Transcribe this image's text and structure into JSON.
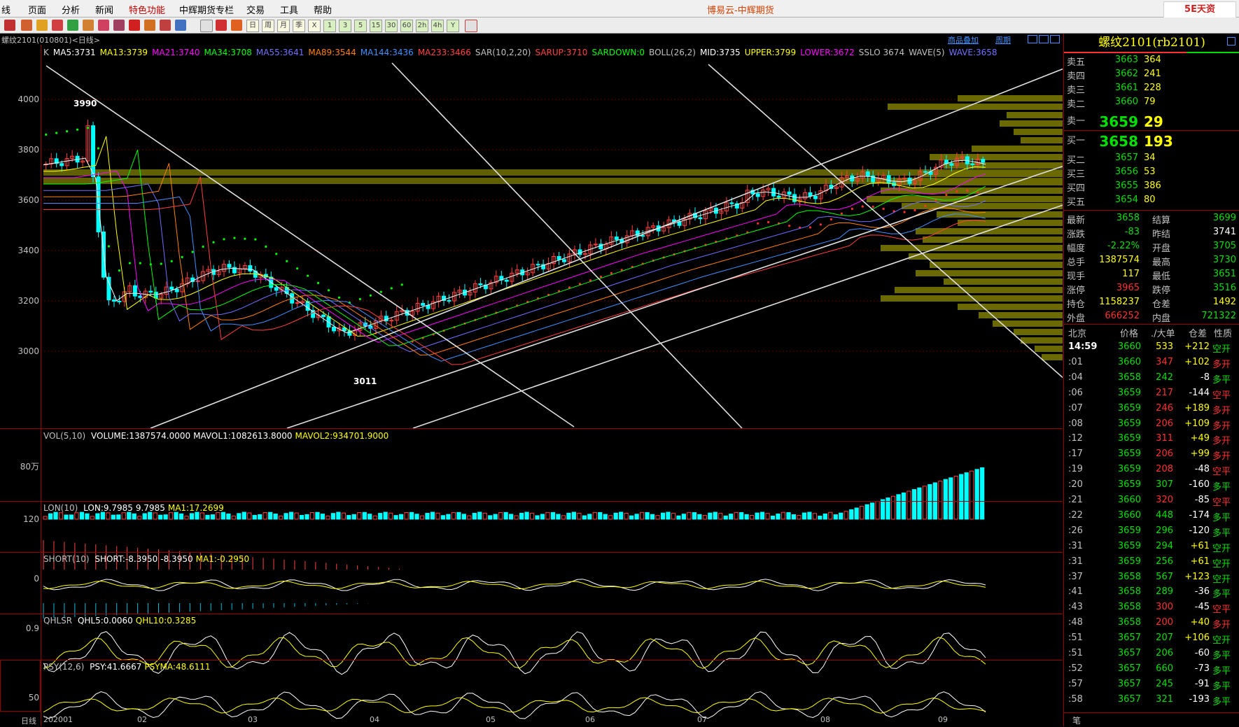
{
  "menu": {
    "items": [
      "线",
      "页面",
      "分析",
      "新闻",
      "特色功能",
      "中辉期货专栏",
      "交易",
      "工具",
      "帮助"
    ],
    "title": "博易云-中辉期货",
    "logo": "5E天资"
  },
  "toolbar": {
    "text_buttons": [
      "日",
      "周",
      "月",
      "季",
      "X",
      "1",
      "3",
      "5",
      "15",
      "30",
      "60",
      "2h",
      "4h",
      "Y"
    ]
  },
  "chart_header": {
    "instrument": "螺纹2101(010801)<日线>",
    "link_overlay": "商品叠加",
    "link_period": "周期"
  },
  "main_legend": [
    {
      "text": "K",
      "color": "#c0c0c0"
    },
    {
      "text": "MA5:3731",
      "color": "#ffffff"
    },
    {
      "text": "MA13:3739",
      "color": "#ffff00"
    },
    {
      "text": "MA21:3740",
      "color": "#ff00ff"
    },
    {
      "text": "MA34:3708",
      "color": "#00ff00"
    },
    {
      "text": "MA55:3641",
      "color": "#7070ff"
    },
    {
      "text": "MA89:3544",
      "color": "#ff8000"
    },
    {
      "text": "MA144:3436",
      "color": "#4090ff"
    },
    {
      "text": "MA233:3466",
      "color": "#ff4040"
    },
    {
      "text": "SAR(10,2,20)",
      "color": "#c0c0c0"
    },
    {
      "text": "SARUP:3710",
      "color": "#ff4040"
    },
    {
      "text": "SARDOWN:0",
      "color": "#00ff00"
    },
    {
      "text": "BOLL(26,2)",
      "color": "#c0c0c0"
    },
    {
      "text": "MID:3735",
      "color": "#ffffff"
    },
    {
      "text": "UPPER:3799",
      "color": "#ffff00"
    },
    {
      "text": "LOWER:3672",
      "color": "#ff00ff"
    },
    {
      "text": "SSLO 3674",
      "color": "#c0c0c0"
    },
    {
      "text": "WAVE(5)",
      "color": "#c0c0c0"
    },
    {
      "text": "WAVE:3658",
      "color": "#7070ff"
    }
  ],
  "y_axis_main": [
    "4000",
    "3800",
    "3600",
    "3400",
    "3200",
    "3000"
  ],
  "annotations": {
    "high": "3990",
    "low": "3011"
  },
  "x_axis": [
    "日线",
    "202001",
    "02",
    "03",
    "04",
    "05",
    "06",
    "07",
    "08",
    "09"
  ],
  "panels": {
    "vol": {
      "label": "VOL(5,10)",
      "items": [
        {
          "text": "VOLUME:1387574.0000",
          "color": "#ffffff"
        },
        {
          "text": "MAVOL1:1082613.8000",
          "color": "#ffffff"
        },
        {
          "text": "MAVOL2:934701.9000",
          "color": "#ffff00"
        }
      ],
      "ytick": "80万"
    },
    "lon": {
      "label": "LON(10)",
      "items": [
        {
          "text": "LON:9.7985",
          "color": "#ffffff"
        },
        {
          "text": "9.7985",
          "color": "#ffffff"
        },
        {
          "text": "MA1:17.2699",
          "color": "#ffff00"
        }
      ],
      "ytick": "120"
    },
    "short": {
      "label": "SHORT(10)",
      "items": [
        {
          "text": "SHORT:-8.3950",
          "color": "#ffffff"
        },
        {
          "text": "-8.3950",
          "color": "#ffffff"
        },
        {
          "text": "MA1:-0.2950",
          "color": "#ffff00"
        }
      ],
      "ytick": "0"
    },
    "qhlsr": {
      "label": "QHLSR",
      "items": [
        {
          "text": "QHL5:0.0060",
          "color": "#ffffff"
        },
        {
          "text": "QHL10:0.3285",
          "color": "#ffff00"
        }
      ],
      "ytick": "0.9"
    },
    "psy": {
      "label": "PSY(12,6)",
      "items": [
        {
          "text": "PSY:41.6667",
          "color": "#ffffff"
        },
        {
          "text": "PSYMA:48.6111",
          "color": "#ffff00"
        }
      ],
      "ytick": "50"
    }
  },
  "quote": {
    "title": "螺纹2101(rb2101)",
    "asks": [
      {
        "label": "卖五",
        "price": "3663",
        "vol": "364"
      },
      {
        "label": "卖四",
        "price": "3662",
        "vol": "241"
      },
      {
        "label": "卖三",
        "price": "3661",
        "vol": "228"
      },
      {
        "label": "卖二",
        "price": "3660",
        "vol": "79"
      },
      {
        "label": "卖一",
        "price": "3659",
        "vol": "29"
      }
    ],
    "bids": [
      {
        "label": "买一",
        "price": "3658",
        "vol": "193"
      },
      {
        "label": "买二",
        "price": "3657",
        "vol": "34"
      },
      {
        "label": "买三",
        "price": "3656",
        "vol": "53"
      },
      {
        "label": "买四",
        "price": "3655",
        "vol": "386"
      },
      {
        "label": "买五",
        "price": "3654",
        "vol": "80"
      }
    ],
    "stats": [
      {
        "l1": "最新",
        "v1": "3658",
        "c1": "#00e000",
        "l2": "结算",
        "v2": "3699",
        "c2": "#00e000"
      },
      {
        "l1": "涨跌",
        "v1": "-83",
        "c1": "#00e000",
        "l2": "昨结",
        "v2": "3741",
        "c2": "#ffffff"
      },
      {
        "l1": "幅度",
        "v1": "-2.22%",
        "c1": "#00e000",
        "l2": "开盘",
        "v2": "3705",
        "c2": "#00e000"
      },
      {
        "l1": "总手",
        "v1": "1387574",
        "c1": "#ffff00",
        "l2": "最高",
        "v2": "3730",
        "c2": "#00e000"
      },
      {
        "l1": "现手",
        "v1": "117",
        "c1": "#ffff00",
        "l2": "最低",
        "v2": "3651",
        "c2": "#00e000"
      },
      {
        "l1": "涨停",
        "v1": "3965",
        "c1": "#ff3030",
        "l2": "跌停",
        "v2": "3516",
        "c2": "#00e000"
      },
      {
        "l1": "持仓",
        "v1": "1158237",
        "c1": "#ffff00",
        "l2": "仓差",
        "v2": "1492",
        "c2": "#ffff00"
      },
      {
        "l1": "外盘",
        "v1": "666252",
        "c1": "#ff3030",
        "l2": "内盘",
        "v2": "721322",
        "c2": "#00e000"
      }
    ],
    "tick_header": {
      "loc": "北京",
      "price": "价格",
      "vol": "./大单",
      "diff": "仓差",
      "nature": "性质"
    },
    "ticks": [
      {
        "t": "14:59",
        "p": "3660",
        "v": "533",
        "vc": "#ffff00",
        "d": "+212",
        "n": "空开",
        "nc": "#00e000"
      },
      {
        "t": ":01",
        "p": "3660",
        "v": "347",
        "vc": "#ff3030",
        "d": "+102",
        "n": "多开",
        "nc": "#ff3030"
      },
      {
        "t": ":04",
        "p": "3658",
        "v": "242",
        "vc": "#00e000",
        "d": "-8",
        "n": "多平",
        "nc": "#00e000"
      },
      {
        "t": ":06",
        "p": "3659",
        "v": "217",
        "vc": "#ff3030",
        "d": "-144",
        "n": "空平",
        "nc": "#ff3030"
      },
      {
        "t": ":07",
        "p": "3659",
        "v": "246",
        "vc": "#ff3030",
        "d": "+189",
        "n": "多开",
        "nc": "#ff3030"
      },
      {
        "t": ":08",
        "p": "3659",
        "v": "206",
        "vc": "#ff3030",
        "d": "+109",
        "n": "多开",
        "nc": "#ff3030"
      },
      {
        "t": ":12",
        "p": "3659",
        "v": "311",
        "vc": "#ff3030",
        "d": "+49",
        "n": "多开",
        "nc": "#ff3030"
      },
      {
        "t": ":17",
        "p": "3659",
        "v": "206",
        "vc": "#ff3030",
        "d": "+99",
        "n": "多开",
        "nc": "#ff3030"
      },
      {
        "t": ":19",
        "p": "3659",
        "v": "208",
        "vc": "#ff3030",
        "d": "-48",
        "n": "空平",
        "nc": "#ff3030"
      },
      {
        "t": ":20",
        "p": "3659",
        "v": "307",
        "vc": "#00e000",
        "d": "-160",
        "n": "多平",
        "nc": "#00e000"
      },
      {
        "t": ":21",
        "p": "3660",
        "v": "320",
        "vc": "#ff3030",
        "d": "-85",
        "n": "空平",
        "nc": "#ff3030"
      },
      {
        "t": ":22",
        "p": "3660",
        "v": "448",
        "vc": "#00e000",
        "d": "-174",
        "n": "多平",
        "nc": "#00e000"
      },
      {
        "t": ":26",
        "p": "3659",
        "v": "296",
        "vc": "#00e000",
        "d": "-120",
        "n": "多平",
        "nc": "#00e000"
      },
      {
        "t": ":31",
        "p": "3659",
        "v": "294",
        "vc": "#00e000",
        "d": "+61",
        "n": "空开",
        "nc": "#00e000"
      },
      {
        "t": ":31",
        "p": "3659",
        "v": "256",
        "vc": "#00e000",
        "d": "+61",
        "n": "空开",
        "nc": "#00e000"
      },
      {
        "t": ":37",
        "p": "3658",
        "v": "567",
        "vc": "#00e000",
        "d": "+123",
        "n": "空开",
        "nc": "#00e000"
      },
      {
        "t": ":41",
        "p": "3658",
        "v": "289",
        "vc": "#00e000",
        "d": "-36",
        "n": "多平",
        "nc": "#00e000"
      },
      {
        "t": ":43",
        "p": "3658",
        "v": "300",
        "vc": "#ff3030",
        "d": "-45",
        "n": "空平",
        "nc": "#ff3030"
      },
      {
        "t": ":48",
        "p": "3658",
        "v": "200",
        "vc": "#ff3030",
        "d": "+40",
        "n": "多开",
        "nc": "#ff3030"
      },
      {
        "t": ":51",
        "p": "3657",
        "v": "207",
        "vc": "#00e000",
        "d": "+106",
        "n": "空开",
        "nc": "#00e000"
      },
      {
        "t": ":51",
        "p": "3657",
        "v": "206",
        "vc": "#00e000",
        "d": "-60",
        "n": "多平",
        "nc": "#00e000"
      },
      {
        "t": ":52",
        "p": "3657",
        "v": "660",
        "vc": "#00e000",
        "d": "-73",
        "n": "多平",
        "nc": "#00e000"
      },
      {
        "t": ":57",
        "p": "3657",
        "v": "245",
        "vc": "#00e000",
        "d": "-91",
        "n": "多平",
        "nc": "#00e000"
      },
      {
        "t": ":58",
        "p": "3657",
        "v": "321",
        "vc": "#00e000",
        "d": "-193",
        "n": "多平",
        "nc": "#00e000"
      }
    ],
    "footer_tab": "笔"
  }
}
